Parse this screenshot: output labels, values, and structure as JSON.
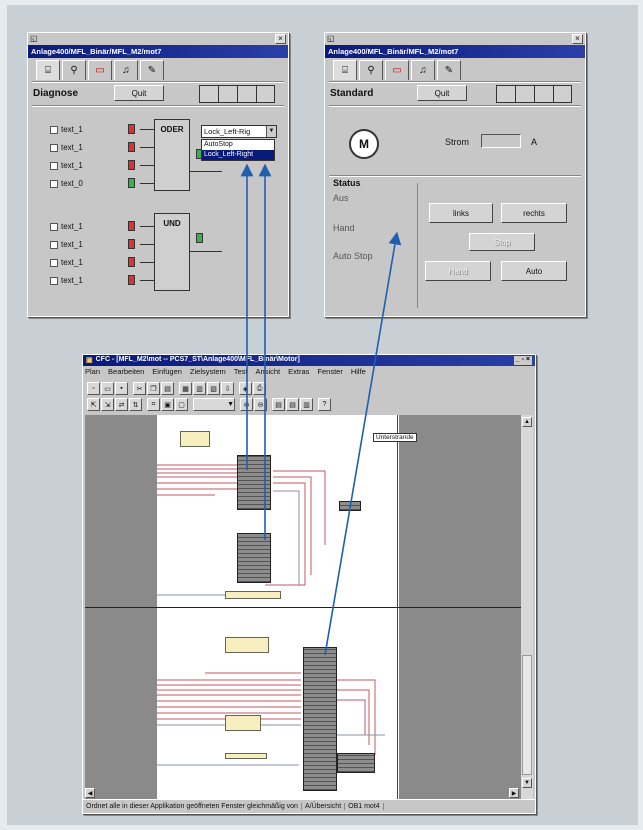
{
  "diag_window": {
    "title": "Anlage400/MFL_Binär/MFL_M2/mot7",
    "heading": "Diagnose",
    "quit_label": "Quit",
    "select_value": "Lock_Left-Rig",
    "dropdown_options": [
      "AutoStop",
      "Lock_Left-Right"
    ],
    "oder_label": "ODER",
    "und_label": "UND",
    "oder_inputs": [
      {
        "label": "text_1",
        "led": "red"
      },
      {
        "label": "text_1",
        "led": "red"
      },
      {
        "label": "text_1",
        "led": "red"
      },
      {
        "label": "text_0",
        "led": "green"
      }
    ],
    "und_inputs": [
      {
        "label": "text_1",
        "led": "red"
      },
      {
        "label": "text_1",
        "led": "red"
      },
      {
        "label": "text_1",
        "led": "red"
      },
      {
        "label": "text_1",
        "led": "red"
      }
    ]
  },
  "std_window": {
    "title": "Anlage400/MFL_Binär/MFL_M2/mot7",
    "heading": "Standard",
    "quit_label": "Quit",
    "motor_label": "M",
    "strom_label": "Strom",
    "strom_unit": "A",
    "status_heading": "Status",
    "status_items": [
      "Aus",
      "Hand",
      "Auto Stop"
    ],
    "btn_links": "links",
    "btn_rechts": "rechts",
    "btn_stop": "Stop",
    "btn_hand": "Hand",
    "btn_auto": "Auto"
  },
  "cfc_window": {
    "title": "CFC - [MFL_M2\\mot -- PCS7_ST\\Anlage400\\MFL_Binär\\Motor]",
    "menu": [
      "Plan",
      "Bearbeiten",
      "Einfügen",
      "Zielsystem",
      "Test",
      "Ansicht",
      "Extras",
      "Fenster",
      "Hilfe"
    ],
    "sheet_tag": "Unterstrande",
    "status_text": "Ordnet alle in dieser Applikation geöffneten Fenster gleichmäßig von",
    "status_seg2": "A/Übersicht",
    "status_seg3": "OB1 mot4"
  },
  "colors": {
    "titlebar": "#0a1a7a",
    "arrow": "#1f5fb0",
    "led_red": "#d8323a",
    "led_green": "#3db04a",
    "wire_red": "#c05a64",
    "block_yellow": "#f7efbf"
  }
}
